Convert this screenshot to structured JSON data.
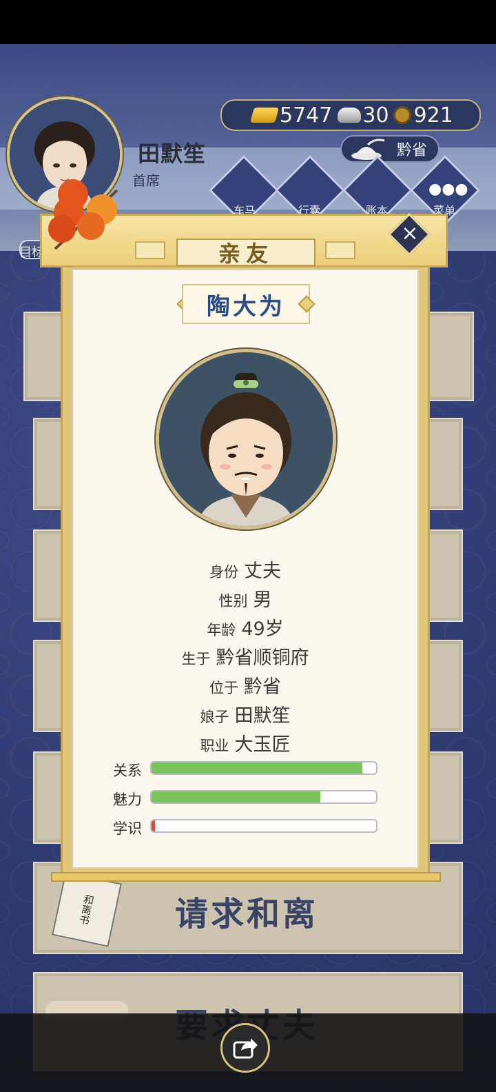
{
  "player": {
    "name": "田默笙",
    "title": "首席",
    "location": "黔省"
  },
  "resources": {
    "gold": "5747",
    "silver": "30",
    "coins": "921"
  },
  "menu": [
    {
      "label": "车马",
      "icon": "carriage-icon"
    },
    {
      "label": "行囊",
      "icon": "bag-icon"
    },
    {
      "label": "账本",
      "icon": "ledger-icon"
    },
    {
      "label": "菜单",
      "icon": "more-icon"
    }
  ],
  "goal_label": "目标",
  "modal": {
    "title": "亲友",
    "npc_name": "陶大为",
    "info": [
      {
        "key": "身份",
        "value": "丈夫"
      },
      {
        "key": "性别",
        "value": "男"
      },
      {
        "key": "年龄",
        "value": "49岁"
      },
      {
        "key": "生于",
        "value": "黔省顺铜府"
      },
      {
        "key": "位于",
        "value": "黔省"
      },
      {
        "key": "娘子",
        "value": "田默笙"
      },
      {
        "key": "职业",
        "value": "大玉匠"
      }
    ],
    "stats": [
      {
        "label": "关系",
        "value": 0.94
      },
      {
        "label": "魅力",
        "value": 0.75
      },
      {
        "label": "学识",
        "value": 0.01
      }
    ]
  },
  "actions": {
    "divorce_label": "请求和离",
    "divorce_paper": "和离书",
    "ask_husband_label": "要求丈夫"
  },
  "colors": {
    "bar_fill": "#78c45a",
    "bar_low": "#d64b3d",
    "accent_gold": "#e8c86a",
    "background": "#2e3a72"
  }
}
